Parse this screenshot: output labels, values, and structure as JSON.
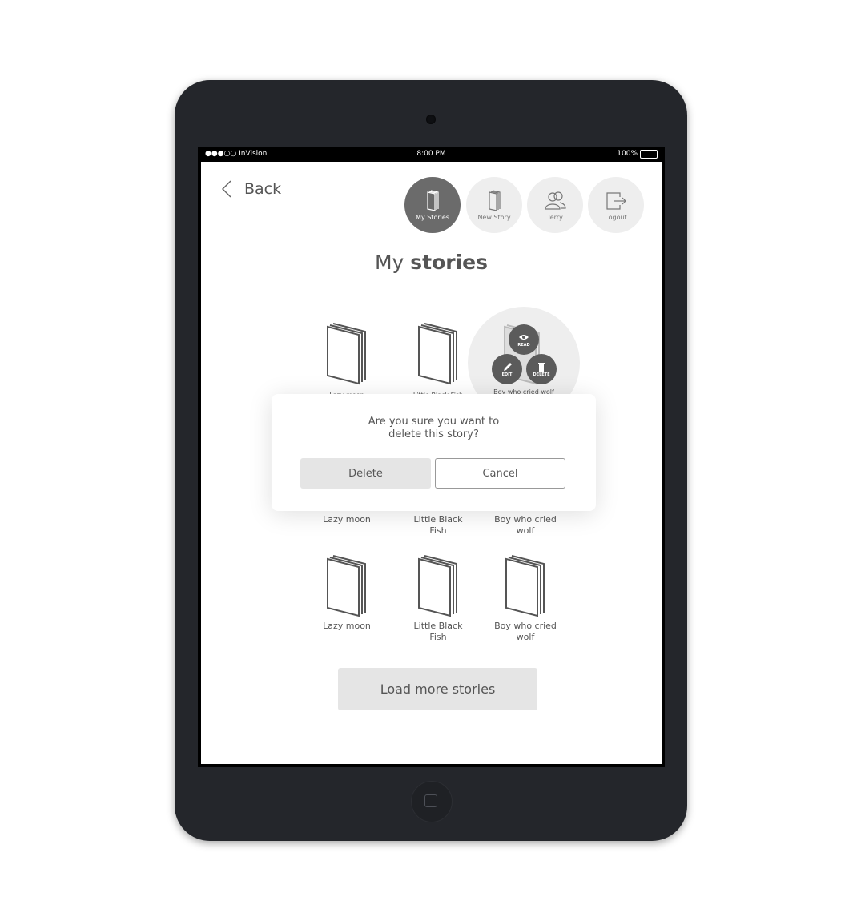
{
  "status_bar": {
    "carrier": "●●●○○ InVision",
    "time": "8:00 PM",
    "battery": "100%"
  },
  "header": {
    "back_label": "Back",
    "nav": [
      {
        "label": "My Stories",
        "icon": "book-icon",
        "active": true
      },
      {
        "label": "New Story",
        "icon": "new-book-icon",
        "active": false
      },
      {
        "label": "Terry",
        "icon": "users-icon",
        "active": false
      },
      {
        "label": "Logout",
        "icon": "logout-icon",
        "active": false
      }
    ]
  },
  "page": {
    "title_light": "My",
    "title_bold": "stories"
  },
  "top_row": [
    "Lazy moon",
    "Little Black Fish",
    "Boy who cried wolf"
  ],
  "story_actions": {
    "read": "READ",
    "edit": "EDIT",
    "delete": "DELETE"
  },
  "middle_row": [
    "Lazy moon",
    "Little Black\nFish",
    "Boy who cried\nwolf"
  ],
  "bottom_row": [
    "Lazy moon",
    "Little Black\nFish",
    "Boy who cried\nwolf"
  ],
  "dialog": {
    "message": "Are you sure you want to\ndelete this story?",
    "delete_label": "Delete",
    "cancel_label": "Cancel"
  },
  "load_more_label": "Load more stories",
  "colors": {
    "device": "#24262b",
    "active_nav": "#6b6b6b",
    "button_gray": "#e5e5e5"
  }
}
